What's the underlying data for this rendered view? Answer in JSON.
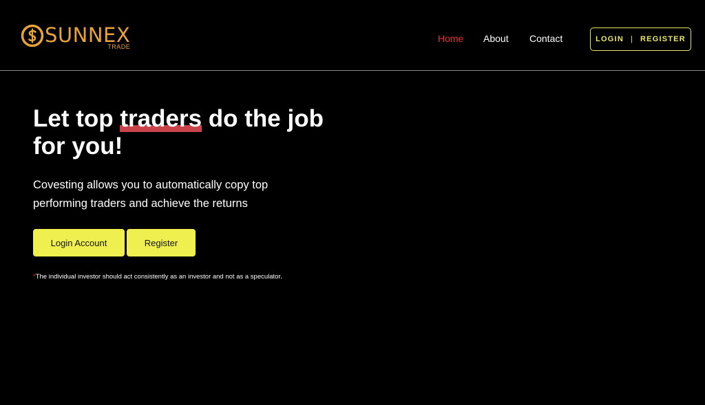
{
  "brand": {
    "name": "SUNNEX",
    "sub": "TRADE",
    "color": "#e8a23a",
    "icon": "dollar-coin-icon"
  },
  "nav": {
    "items": [
      {
        "label": "Home",
        "active": true
      },
      {
        "label": "About",
        "active": false
      },
      {
        "label": "Contact",
        "active": false
      }
    ],
    "active_color": "#e8302e"
  },
  "auth": {
    "login_label": "LOGIN",
    "separator": "|",
    "register_label": "REGISTER",
    "color": "#e9e866"
  },
  "hero": {
    "title_before": "Let top ",
    "title_highlight": "traders",
    "title_after": " do the job for you!",
    "highlight_color": "#c9444a",
    "subtitle": "Covesting allows you to automatically copy top performing traders and achieve the returns",
    "login_button": "Login Account",
    "register_button": "Register",
    "button_color": "#eff050",
    "disclaimer_mark": "*",
    "disclaimer": "The individual investor should act consistently as an investor and not as a speculator."
  }
}
